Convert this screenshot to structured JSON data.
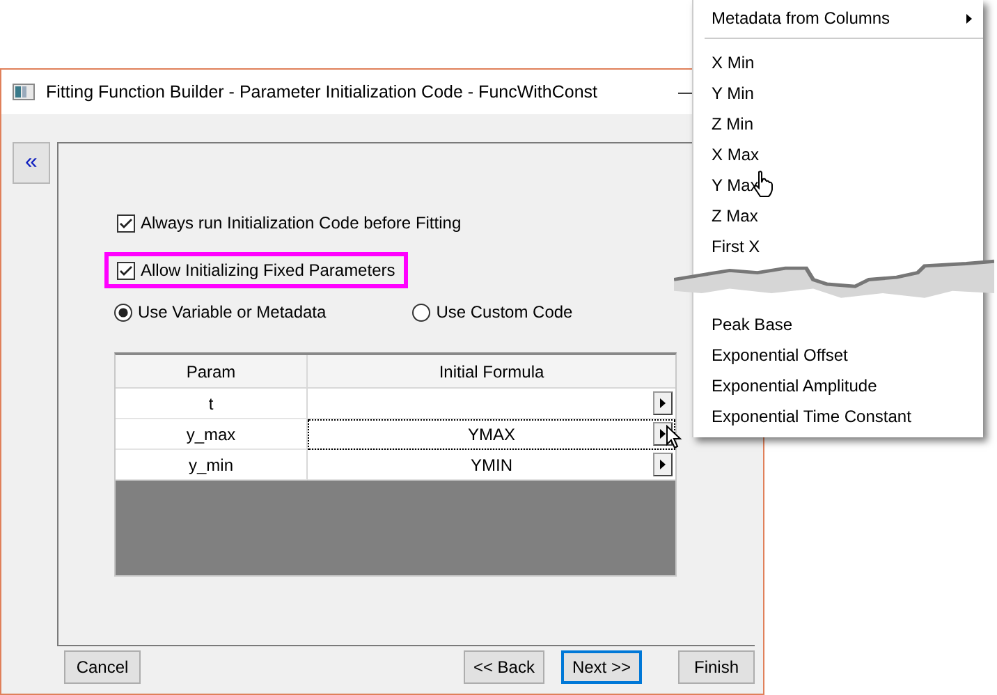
{
  "window": {
    "title": "Fitting Function Builder - Parameter Initialization Code - FuncWithConst",
    "minimize": "—"
  },
  "sidebar": {
    "collapse": "«"
  },
  "options": [
    {
      "label": "Always run Initialization Code before Fitting",
      "checked": true,
      "highlighted": false
    },
    {
      "label": "Allow Initializing Fixed Parameters",
      "checked": true,
      "highlighted": true
    }
  ],
  "radios": [
    {
      "label": "Use Variable or Metadata",
      "selected": true
    },
    {
      "label": "Use Custom Code",
      "selected": false
    }
  ],
  "table": {
    "columns": [
      "Param",
      "Initial Formula"
    ],
    "rows": [
      {
        "param": "t",
        "formula": "",
        "focused": false
      },
      {
        "param": "y_max",
        "formula": "YMAX",
        "focused": true
      },
      {
        "param": "y_min",
        "formula": "YMIN",
        "focused": false
      }
    ]
  },
  "buttons": [
    {
      "label": "Cancel",
      "default": false,
      "kind": "left"
    },
    {
      "label": "<< Back",
      "default": false,
      "kind": "right"
    },
    {
      "label": "Next >>",
      "default": true,
      "kind": "right"
    },
    {
      "label": "Finish",
      "default": false,
      "kind": "right"
    }
  ],
  "menu": {
    "items": [
      {
        "kind": "submenu",
        "label": "Metadata from Columns"
      },
      {
        "kind": "separator"
      },
      {
        "kind": "item",
        "label": "X Min"
      },
      {
        "kind": "item",
        "label": "Y Min"
      },
      {
        "kind": "item",
        "label": "Z Min"
      },
      {
        "kind": "item",
        "label": "X Max"
      },
      {
        "kind": "item",
        "label": "Y Max"
      },
      {
        "kind": "item",
        "label": "Z Max"
      },
      {
        "kind": "item",
        "label": "First X"
      },
      {
        "kind": "tear"
      },
      {
        "kind": "item",
        "label": "Peak Base"
      },
      {
        "kind": "item",
        "label": "Exponential Offset"
      },
      {
        "kind": "item",
        "label": "Exponential Amplitude"
      },
      {
        "kind": "item",
        "label": "Exponential Time Constant"
      }
    ]
  }
}
